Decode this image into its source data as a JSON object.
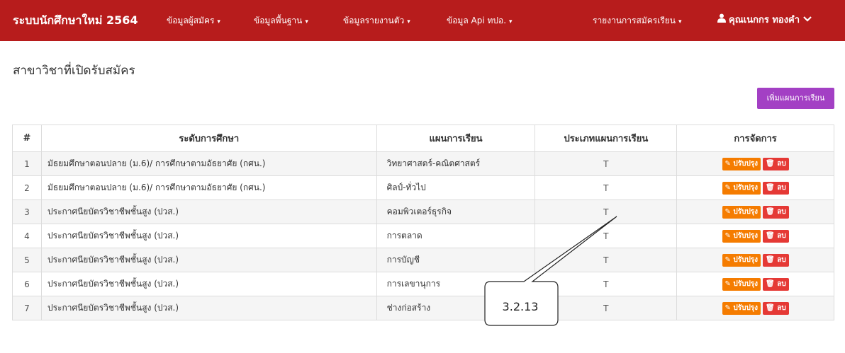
{
  "navbar": {
    "brand": "ระบบนักศึกษาใหม่ 2564",
    "menu": [
      {
        "label": "ข้อมูลผู้สมัคร"
      },
      {
        "label": "ข้อมูลพื้นฐาน"
      },
      {
        "label": "ข้อมูลรายงานตัว"
      },
      {
        "label": "ข้อมูล Api ทปอ."
      },
      {
        "label": "รายงานการสมัครเรียน"
      }
    ],
    "user": "คุณเนกกร ทองคำ",
    "colors": {
      "navbar": "#b71c1c"
    }
  },
  "page": {
    "title": "สาขาวิชาที่เปิดรับสมัคร",
    "add_button": "เพิ่มแผนการเรียน"
  },
  "table": {
    "headers": [
      "#",
      "ระดับการศึกษา",
      "แผนการเรียน",
      "ประเภทแผนการเรียน",
      "การจัดการ"
    ],
    "edit_label": "ปรับปรุง",
    "delete_label": "ลบ",
    "rows": [
      {
        "num": "1",
        "level": "มัธยมศึกษาตอนปลาย (ม.6)/ การศึกษาตามอัธยาศัย (กศน.)",
        "plan": "วิทยาศาสตร์-คณิตศาสตร์",
        "type": "T"
      },
      {
        "num": "2",
        "level": "มัธยมศึกษาตอนปลาย (ม.6)/ การศึกษาตามอัธยาศัย (กศน.)",
        "plan": "ศิลป์-ทั่วไป",
        "type": "T"
      },
      {
        "num": "3",
        "level": "ประกาศนียบัตรวิชาชีพชั้นสูง (ปวส.)",
        "plan": "คอมพิวเตอร์ธุรกิจ",
        "type": "T"
      },
      {
        "num": "4",
        "level": "ประกาศนียบัตรวิชาชีพชั้นสูง (ปวส.)",
        "plan": "การตลาด",
        "type": "T"
      },
      {
        "num": "5",
        "level": "ประกาศนียบัตรวิชาชีพชั้นสูง (ปวส.)",
        "plan": "การบัญชี",
        "type": "T"
      },
      {
        "num": "6",
        "level": "ประกาศนียบัตรวิชาชีพชั้นสูง (ปวส.)",
        "plan": "การเลขานุการ",
        "type": "T"
      },
      {
        "num": "7",
        "level": "ประกาศนียบัตรวิชาชีพชั้นสูง (ปวส.)",
        "plan": "ช่างก่อสร้าง",
        "type": "T"
      }
    ]
  },
  "callout": {
    "label": "3.2.13"
  },
  "icons": {
    "edit": "pencil-icon",
    "delete": "trash-icon",
    "user": "user-icon",
    "caret": "caret-down-icon",
    "chevron": "chevron-down-icon"
  }
}
